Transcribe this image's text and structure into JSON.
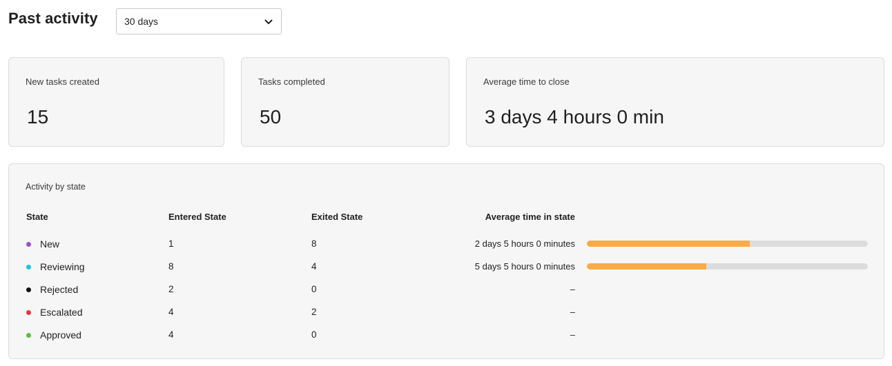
{
  "header": {
    "title": "Past activity",
    "range_select": {
      "value": "30 days"
    }
  },
  "stats": [
    {
      "label": "New tasks created",
      "value": "15"
    },
    {
      "label": "Tasks completed",
      "value": "50"
    },
    {
      "label": "Average time to close",
      "value": "3 days 4 hours 0 min"
    }
  ],
  "activity": {
    "title": "Activity by state",
    "columns": {
      "state": "State",
      "entered": "Entered State",
      "exited": "Exited State",
      "avg_time": "Average time in state"
    },
    "rows": [
      {
        "state": "New",
        "color": "#9b4fd1",
        "entered": "1",
        "exited": "8",
        "avg_time": "2 days 5 hours 0 minutes",
        "bar_fraction": 0.58
      },
      {
        "state": "Reviewing",
        "color": "#19c6e6",
        "entered": "8",
        "exited": "4",
        "avg_time": "5 days 5 hours 0 minutes",
        "bar_fraction": 0.425
      },
      {
        "state": "Rejected",
        "color": "#111111",
        "entered": "2",
        "exited": "0",
        "avg_time": "–",
        "bar_fraction": null
      },
      {
        "state": "Escalated",
        "color": "#e53935",
        "entered": "4",
        "exited": "2",
        "avg_time": "–",
        "bar_fraction": null
      },
      {
        "state": "Approved",
        "color": "#5bbf3a",
        "entered": "4",
        "exited": "0",
        "avg_time": "–",
        "bar_fraction": null
      }
    ],
    "bar_color": "#f9ab46",
    "bar_track_color": "#dcdcdc"
  }
}
